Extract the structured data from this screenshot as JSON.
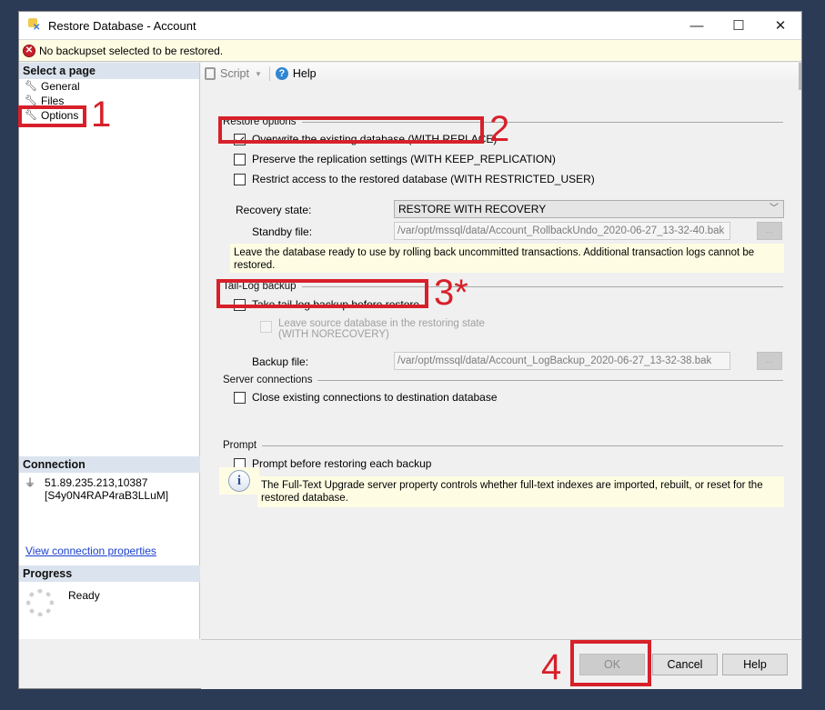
{
  "window": {
    "title": "Restore Database - Account",
    "controls": {
      "minimize": "—",
      "maximize": "☐",
      "close": "✕"
    }
  },
  "warning": {
    "icon": "error-icon",
    "text": "No backupset selected to be restored."
  },
  "sidebar": {
    "header": "Select a page",
    "items": [
      {
        "label": "General",
        "icon": "wrench-icon"
      },
      {
        "label": "Files",
        "icon": "wrench-icon"
      },
      {
        "label": "Options",
        "icon": "wrench-icon"
      }
    ],
    "connection": {
      "header": "Connection",
      "server": "51.89.235.213,10387",
      "user": "[S4y0N4RAP4raB3LLuM]",
      "link": "View connection properties"
    },
    "progress": {
      "header": "Progress",
      "status": "Ready"
    }
  },
  "toolbar": {
    "script_label": "Script",
    "help_label": "Help"
  },
  "restore_options": {
    "header": "Restore options",
    "overwrite": {
      "label": "Overwrite the existing database (WITH REPLACE)",
      "checked": true
    },
    "preserve_replication": {
      "label": "Preserve the replication settings (WITH KEEP_REPLICATION)",
      "checked": false
    },
    "restrict_access": {
      "label": "Restrict access to the restored database (WITH RESTRICTED_USER)",
      "checked": false
    },
    "recovery_state_label": "Recovery state:",
    "recovery_state_value": "RESTORE WITH RECOVERY",
    "standby_label": "Standby file:",
    "standby_value": "/var/opt/mssql/data/Account_RollbackUndo_2020-06-27_13-32-40.bak",
    "browse_label": "...",
    "note": "Leave the database ready to use by rolling back uncommitted transactions. Additional transaction logs cannot be restored."
  },
  "tail_log": {
    "header": "Tail-Log backup",
    "take_backup": {
      "label": "Take tail-log backup before restore",
      "checked": false
    },
    "leave_restoring": {
      "label_line1": "Leave source database in the restoring state",
      "label_line2": "(WITH NORECOVERY)",
      "checked": false,
      "disabled": true
    },
    "backup_file_label": "Backup file:",
    "backup_file_value": "/var/opt/mssql/data/Account_LogBackup_2020-06-27_13-32-38.bak",
    "browse_label": "..."
  },
  "server_connections": {
    "header": "Server connections",
    "close_connections": {
      "label": "Close existing connections to destination database",
      "checked": false
    }
  },
  "prompt": {
    "header": "Prompt",
    "prompt_each": {
      "label": "Prompt before restoring each backup",
      "checked": false
    },
    "info": "The Full-Text Upgrade server property controls whether full-text indexes are imported, rebuilt, or reset for the restored database."
  },
  "buttons": {
    "ok": "OK",
    "cancel": "Cancel",
    "help": "Help"
  },
  "annotations": {
    "a1": "1",
    "a2": "2",
    "a3": "3*",
    "a4": "4"
  },
  "colors": {
    "annotation": "#d7202a",
    "warning_bg": "#fefde3",
    "section_header_bg": "#dbe4ee",
    "link": "#1a3fd0"
  }
}
